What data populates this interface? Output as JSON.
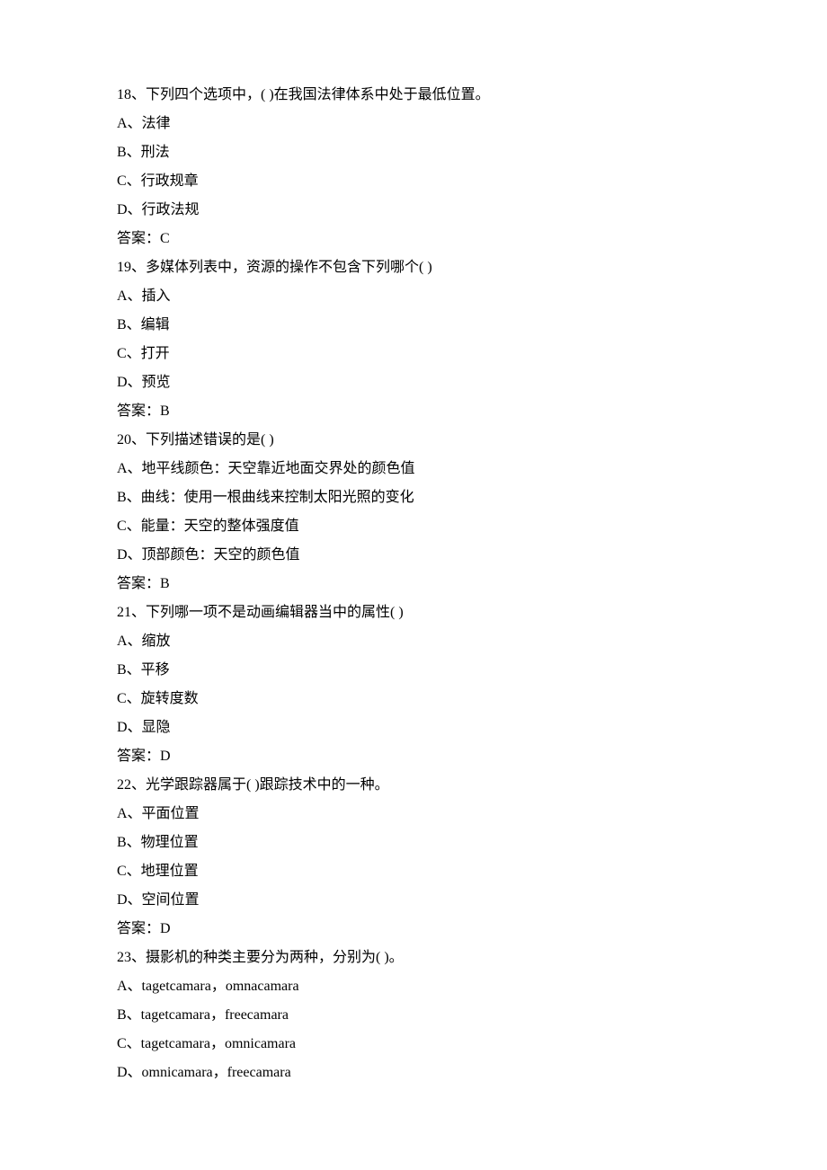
{
  "questions": [
    {
      "stem": "18、下列四个选项中，( )在我国法律体系中处于最低位置。",
      "options": [
        "A、法律",
        "B、刑法",
        "C、行政规章",
        "D、行政法规"
      ],
      "answer": "答案：C"
    },
    {
      "stem": "19、多媒体列表中，资源的操作不包含下列哪个( )",
      "options": [
        "A、插入",
        "B、编辑",
        "C、打开",
        "D、预览"
      ],
      "answer": "答案：B"
    },
    {
      "stem": "20、下列描述错误的是( )",
      "options": [
        "A、地平线颜色：天空靠近地面交界处的颜色值",
        "B、曲线：使用一根曲线来控制太阳光照的变化",
        "C、能量：天空的整体强度值",
        "D、顶部颜色：天空的颜色值"
      ],
      "answer": "答案：B"
    },
    {
      "stem": "21、下列哪一项不是动画编辑器当中的属性( )",
      "options": [
        "A、缩放",
        "B、平移",
        "C、旋转度数",
        "D、显隐"
      ],
      "answer": "答案：D"
    },
    {
      "stem": "22、光学跟踪器属于( )跟踪技术中的一种。",
      "options": [
        "A、平面位置",
        "B、物理位置",
        "C、地理位置",
        "D、空间位置"
      ],
      "answer": "答案：D"
    },
    {
      "stem": "23、摄影机的种类主要分为两种，分别为( )。",
      "options": [
        "A、tagetcamara，omnacamara",
        "B、tagetcamara，freecamara",
        "C、tagetcamara，omnicamara",
        "D、omnicamara，freecamara"
      ],
      "answer": ""
    }
  ]
}
